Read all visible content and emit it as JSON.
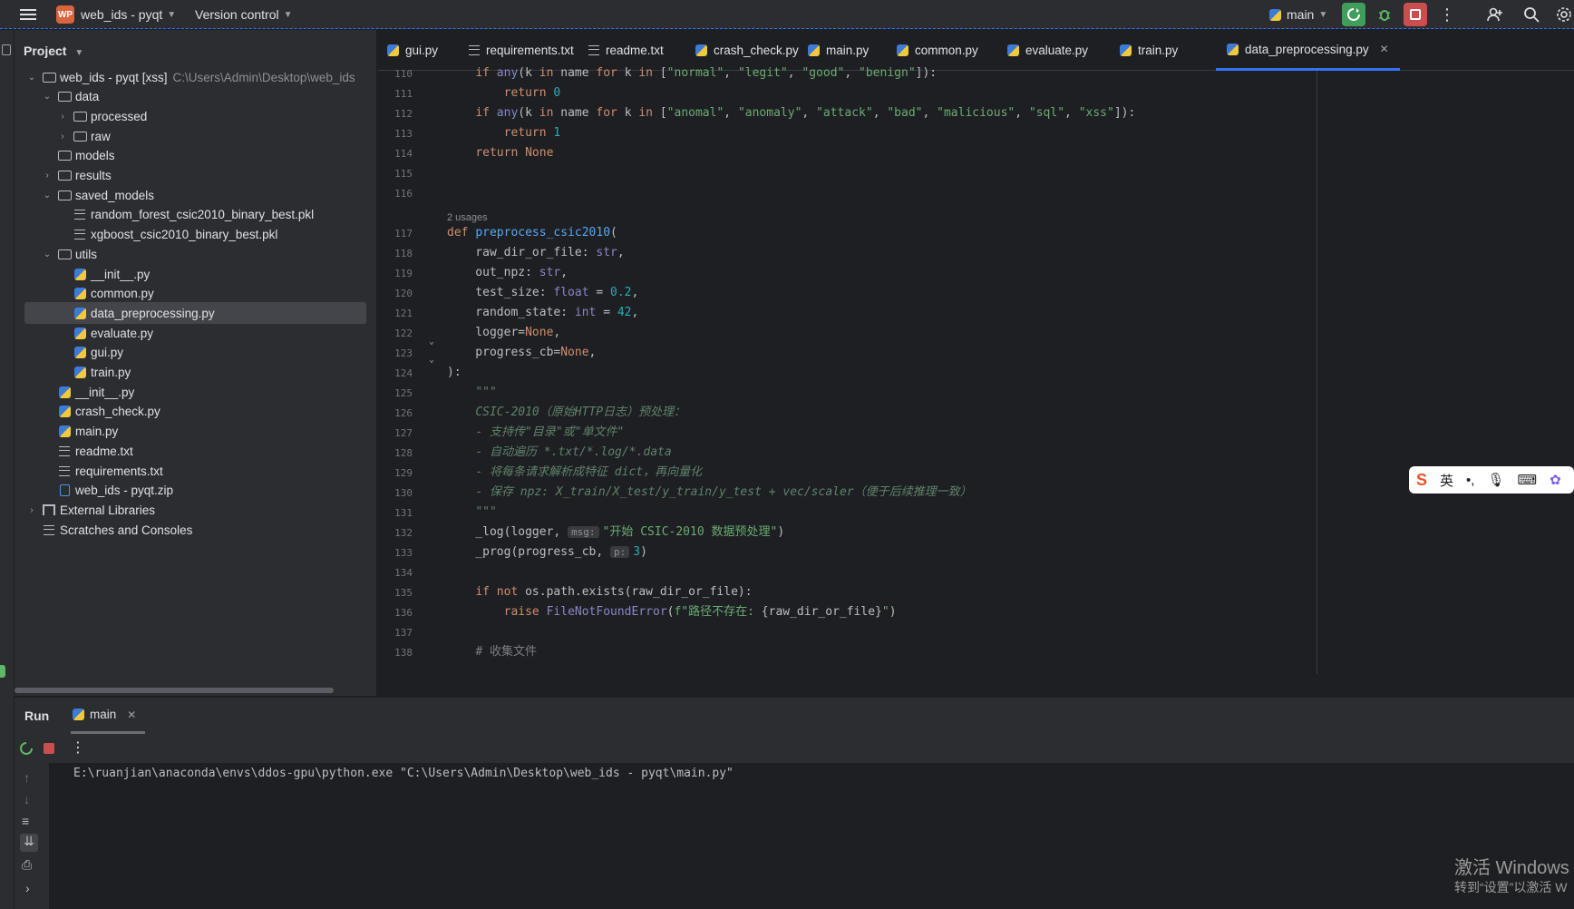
{
  "titlebar": {
    "project_badge": "WP",
    "project_name": "web_ids - pyqt",
    "vcs": "Version control",
    "run_config": "main"
  },
  "project_panel": {
    "title": "Project",
    "tree": [
      {
        "label": "web_ids - pyqt [xss]",
        "path": "C:\\Users\\Admin\\Desktop\\web_ids",
        "kind": "project",
        "expanded": true,
        "depth": 0
      },
      {
        "label": "data",
        "kind": "folder",
        "expanded": true,
        "depth": 1
      },
      {
        "label": "processed",
        "kind": "folder",
        "collapsed": true,
        "depth": 2
      },
      {
        "label": "raw",
        "kind": "folder",
        "collapsed": true,
        "depth": 2
      },
      {
        "label": "models",
        "kind": "folder",
        "depth": 1
      },
      {
        "label": "results",
        "kind": "folder",
        "collapsed": true,
        "depth": 1
      },
      {
        "label": "saved_models",
        "kind": "folder",
        "expanded": true,
        "depth": 1
      },
      {
        "label": "random_forest_csic2010_binary_best.pkl",
        "kind": "file",
        "depth": 2
      },
      {
        "label": "xgboost_csic2010_binary_best.pkl",
        "kind": "file",
        "depth": 2
      },
      {
        "label": "utils",
        "kind": "package",
        "expanded": true,
        "depth": 1
      },
      {
        "label": "__init__.py",
        "kind": "python",
        "depth": 2
      },
      {
        "label": "common.py",
        "kind": "python",
        "depth": 2
      },
      {
        "label": "data_preprocessing.py",
        "kind": "python",
        "depth": 2,
        "selected": true
      },
      {
        "label": "evaluate.py",
        "kind": "python",
        "depth": 2
      },
      {
        "label": "gui.py",
        "kind": "python",
        "depth": 2
      },
      {
        "label": "train.py",
        "kind": "python",
        "depth": 2
      },
      {
        "label": "__init__.py",
        "kind": "python",
        "depth": 1
      },
      {
        "label": "crash_check.py",
        "kind": "python",
        "depth": 1
      },
      {
        "label": "main.py",
        "kind": "python",
        "depth": 1
      },
      {
        "label": "readme.txt",
        "kind": "text",
        "depth": 1
      },
      {
        "label": "requirements.txt",
        "kind": "text",
        "depth": 1
      },
      {
        "label": "web_ids - pyqt.zip",
        "kind": "zip",
        "depth": 1
      },
      {
        "label": "External Libraries",
        "kind": "library",
        "collapsed": true,
        "depth": 0
      },
      {
        "label": "Scratches and Consoles",
        "kind": "scratch",
        "depth": 0
      }
    ]
  },
  "tabs": [
    {
      "label": "gui.py",
      "kind": "python"
    },
    {
      "label": "requirements.txt",
      "kind": "text"
    },
    {
      "label": "readme.txt",
      "kind": "text"
    },
    {
      "label": "crash_check.py",
      "kind": "python"
    },
    {
      "label": "main.py",
      "kind": "python"
    },
    {
      "label": "common.py",
      "kind": "python"
    },
    {
      "label": "evaluate.py",
      "kind": "python"
    },
    {
      "label": "train.py",
      "kind": "python"
    },
    {
      "label": "data_preprocessing.py",
      "kind": "python",
      "active": true
    }
  ],
  "editor": {
    "usages": "2 usages",
    "line_numbers": [
      "110",
      "111",
      "112",
      "113",
      "114",
      "115",
      "116",
      "117",
      "118",
      "119",
      "120",
      "121",
      "122",
      "123",
      "124",
      "125",
      "126",
      "127",
      "128",
      "129",
      "130",
      "131",
      "132",
      "133",
      "134",
      "135",
      "136",
      "137",
      "138"
    ]
  },
  "ime": {
    "lang": "英"
  },
  "run_panel": {
    "tab_run": "Run",
    "tab_main": "main",
    "console_line": "E:\\ruanjian\\anaconda\\envs\\ddos-gpu\\python.exe \"C:\\Users\\Admin\\Desktop\\web_ids - pyqt\\main.py\""
  },
  "watermark": {
    "line1": "激活 Windows",
    "line2": "转到“设置”以激活 W"
  }
}
